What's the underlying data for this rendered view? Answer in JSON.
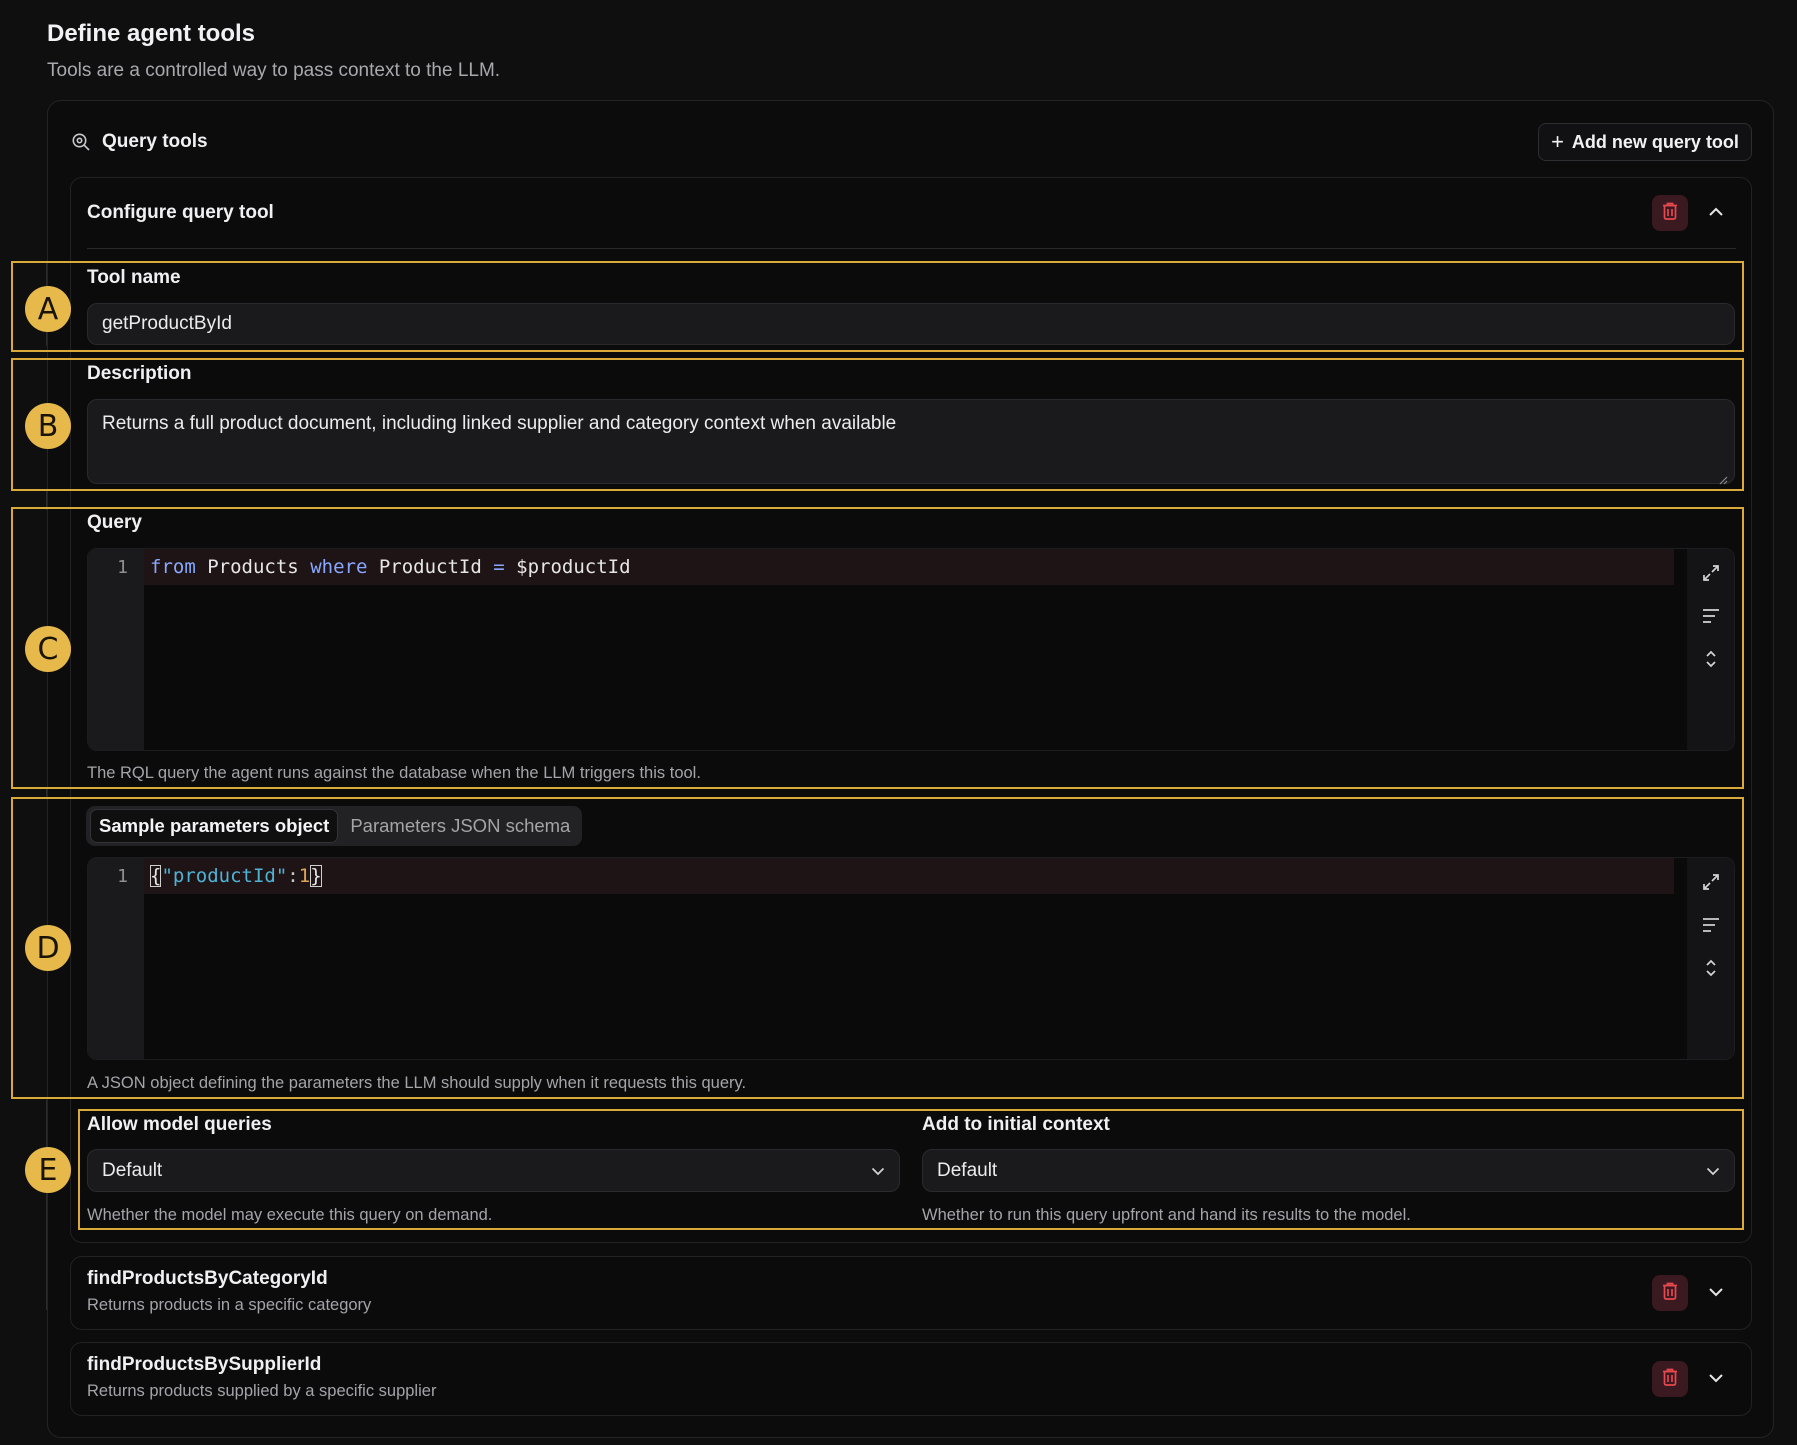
{
  "header": {
    "title": "Define agent tools",
    "subtitle": "Tools are a controlled way to pass context to the LLM."
  },
  "query_tools": {
    "section_label": "Query tools",
    "add_button_label": "Add new query tool"
  },
  "configure": {
    "title": "Configure query tool",
    "tool_name_label": "Tool name",
    "tool_name_value": "getProductById",
    "description_label": "Description",
    "description_value": "Returns a full product document, including linked supplier and category context when available",
    "query_label": "Query",
    "query_line_number": "1",
    "query_code": {
      "kw_from": "from",
      "collection": "Products",
      "kw_where": "where",
      "field": "ProductId",
      "operator": "=",
      "param": "$productId"
    },
    "query_help": "The RQL query the agent runs against the database when the LLM triggers this tool.",
    "params_tabs": [
      "Sample parameters object",
      "Parameters JSON schema"
    ],
    "params_active_tab": "Sample parameters object",
    "params_line_number": "1",
    "params_code": {
      "open": "{",
      "key": "\"productId\"",
      "colon": ":",
      "value": "1",
      "close": "}"
    },
    "params_help": "A JSON object defining the parameters the LLM should supply when it requests this query.",
    "allow_model_queries": {
      "label": "Allow model queries",
      "value": "Default",
      "help": "Whether the model may execute this query on demand."
    },
    "add_to_initial_context": {
      "label": "Add to initial context",
      "value": "Default",
      "help": "Whether to run this query upfront and hand its results to the model."
    }
  },
  "annotations": [
    "A",
    "B",
    "C",
    "D",
    "E"
  ],
  "other_tools": [
    {
      "name": "findProductsByCategoryId",
      "description": "Returns products in a specific category"
    },
    {
      "name": "findProductsBySupplierId",
      "description": "Returns products supplied by a specific supplier"
    }
  ],
  "colors": {
    "background": "#0f0f10",
    "annotation_frame": "#d9a93a",
    "annotation_badge": "#e7b94a",
    "danger_bg": "#3a1a20",
    "danger_icon": "#e5484d"
  },
  "icons": {
    "section": "search-zoom-icon",
    "trash": "trash-icon",
    "collapse": "chevron-up-icon",
    "expand": "chevron-down-icon",
    "fullscreen": "expand-arrows-icon",
    "format": "align-lines-icon",
    "fold": "unfold-icon"
  }
}
